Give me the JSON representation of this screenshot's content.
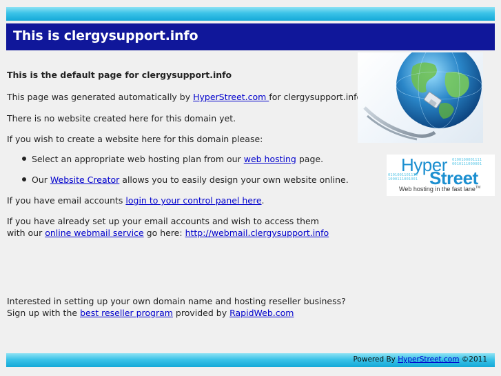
{
  "header": {
    "title": "This is clergysupport.info"
  },
  "content": {
    "heading": "This is the default page for clergysupport.info",
    "generated": {
      "prefix": "This page was generated automatically by ",
      "link": "HyperStreet.com ",
      "suffix": "for clergysupport.info."
    },
    "no_site": "There is no website created here for this domain yet.",
    "create_intro": "If you wish to create a website here for this domain please:",
    "bullet1": {
      "prefix": "Select an appropriate web hosting plan from our ",
      "link": "web hosting",
      "suffix": " page."
    },
    "bullet2": {
      "prefix": "Our ",
      "link": "Website Creator",
      "suffix": " allows you to easily design your own website online."
    },
    "email": {
      "prefix": "If you have email accounts ",
      "link": "login to your control panel here",
      "suffix": "."
    },
    "webmail_line1": "If you have already set up your email accounts and wish to access them",
    "webmail_line2": {
      "prefix": "with our ",
      "link": "online webmail service",
      "middle": " go here: ",
      "link2": "http://webmail.clergysupport.info"
    },
    "reseller_line1": "Interested in setting up your own domain name and hosting reseller business?",
    "reseller_line2": {
      "prefix": "Sign up with the ",
      "link": "best reseller program",
      "middle": " provided by ",
      "link2": "RapidWeb.com "
    }
  },
  "logo": {
    "hyper": "Hyper",
    "street": "Street",
    "tagline": "Web hosting in the fast lane",
    "tm": "TM",
    "bits_top": "0100100001111\n0010111000001",
    "bits_left": "0101001101110\n1000111001001"
  },
  "footer": {
    "prefix": "Powered By ",
    "link": "HyperStreet.com",
    "suffix": " ©2011"
  },
  "colors": {
    "header_bg": "#10179a",
    "bar_cyan": "#3cc3e8",
    "link": "#0000cc",
    "logo_blue": "#1c8fd0"
  }
}
